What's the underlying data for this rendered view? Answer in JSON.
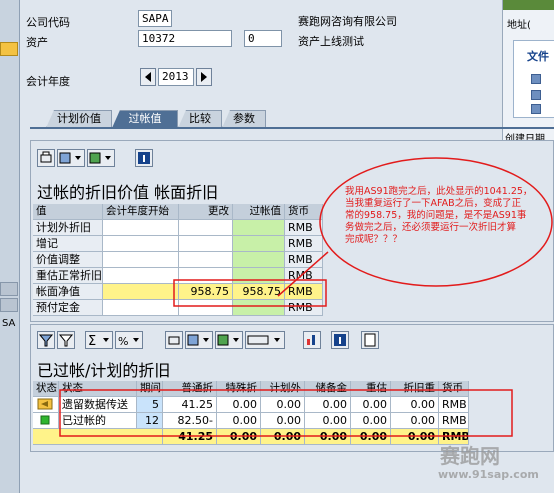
{
  "header": {
    "company_code_label": "公司代码",
    "company_code_value": "SAPA",
    "company_name": "赛跑网咨询有限公司",
    "asset_label": "资产",
    "asset_value": "10372",
    "asset_sub_value": "0",
    "asset_desc": "资产上线测试",
    "fiscal_year_label": "会计年度",
    "fiscal_year_value": "2013"
  },
  "popup": {
    "address_label": "地址(",
    "file_label": "文件",
    "date_label": "创建日期"
  },
  "tabs": [
    "计划价值",
    "过帐值",
    "比较",
    "参数"
  ],
  "active_tab": 1,
  "top_panel": {
    "title": "过帐的折旧价值 帐面折旧",
    "headers": [
      "值",
      "会计年度开始",
      "更改",
      "过帐值",
      "货币"
    ],
    "rows": [
      {
        "label": "计划外折旧",
        "start": "",
        "change": "",
        "posted": "",
        "currency": "RMB"
      },
      {
        "label": "增记",
        "start": "",
        "change": "",
        "posted": "",
        "currency": "RMB"
      },
      {
        "label": "价值调整",
        "start": "",
        "change": "",
        "posted": "",
        "currency": "RMB"
      },
      {
        "label": "重估正常折旧",
        "start": "",
        "change": "",
        "posted": "",
        "currency": "RMB"
      },
      {
        "label": "帐面净值",
        "start": "",
        "change": "958.75",
        "posted": "958.75",
        "currency": "RMB"
      },
      {
        "label": "预付定金",
        "start": "",
        "change": "",
        "posted": "",
        "currency": "RMB"
      }
    ]
  },
  "bottom_panel": {
    "title": "已过帐/计划的折旧",
    "headers": [
      "状态",
      "状态",
      "期间",
      "普通折",
      "特殊折",
      "计划外",
      "储备金",
      "重估",
      "折旧重",
      "货币"
    ],
    "rows": [
      {
        "status_text": "遗留数据传送",
        "period": "5",
        "ordinary": "41.25",
        "special": "0.00",
        "unplanned": "0.00",
        "reserve": "0.00",
        "reval": "0.00",
        "depr_reval": "0.00",
        "currency": "RMB"
      },
      {
        "status_text": "已过帐的",
        "period": "12",
        "ordinary": "82.50-",
        "special": "0.00",
        "unplanned": "0.00",
        "reserve": "0.00",
        "reval": "0.00",
        "depr_reval": "0.00",
        "currency": "RMB"
      }
    ],
    "total": {
      "ordinary": "41.25",
      "special": "0.00",
      "unplanned": "0.00",
      "reserve": "0.00",
      "reval": "0.00",
      "depr_reval": "0.00",
      "currency": "RMB"
    }
  },
  "annotation": {
    "lines": [
      "我用AS91跑完之后，此处显示的1041.25，",
      "当我重复运行了一下AFAB之后，变成了正",
      "常的958.75，我的问题是，是不是AS91事",
      "务做完之后，还必须要运行一次折旧才算",
      "完成呢？？？"
    ]
  },
  "watermark": {
    "site": "赛跑网",
    "url": "www.91sap.com"
  },
  "colors": {
    "accent": "#4f6f95",
    "highlight_yellow": "#fff38a",
    "posted_green": "#c8f0a8",
    "annotation_red": "#e21b1b"
  }
}
